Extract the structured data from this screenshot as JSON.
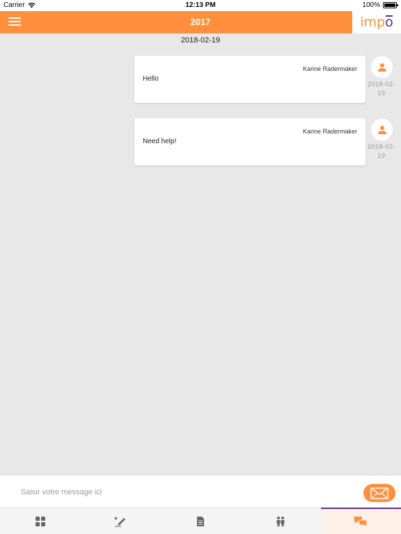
{
  "status_bar": {
    "carrier": "Carrier",
    "time": "12:13 PM",
    "battery": "100%"
  },
  "header": {
    "title": "2017",
    "logo": "impo"
  },
  "chat": {
    "date_separator": "2018-02-19",
    "messages": [
      {
        "sender": "Karine Radermaker",
        "text": "Hello",
        "date_line1": "2018-02-",
        "date_line2": "19"
      },
      {
        "sender": "Karine Radermaker",
        "text": "Need help!",
        "date_line1": "2018-02-",
        "date_line2": "19"
      }
    ]
  },
  "composer": {
    "placeholder": "Saisir votre message ici",
    "value": ""
  },
  "tabs": [
    {
      "icon": "dashboard-icon",
      "active": false
    },
    {
      "icon": "edit-icon",
      "active": false
    },
    {
      "icon": "document-icon",
      "active": false
    },
    {
      "icon": "people-icon",
      "active": false
    },
    {
      "icon": "chat-icon",
      "active": true
    }
  ],
  "colors": {
    "accent": "#ff8f3d",
    "brand_purple": "#5a2d82",
    "background": "#e8e8e8"
  }
}
